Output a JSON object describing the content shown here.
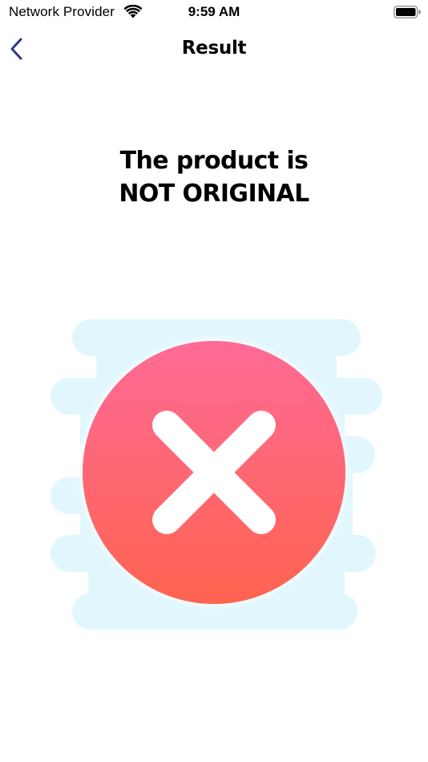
{
  "status_bar": {
    "carrier": "Network Provider",
    "time": "9:59 AM",
    "wifi_icon": "wifi-icon",
    "battery_icon": "battery-icon"
  },
  "nav": {
    "title": "Result",
    "back_icon": "chevron-left-icon"
  },
  "result": {
    "line1": "The product is",
    "line2": "NOT ORIGINAL",
    "status_icon": "x-circle-icon"
  },
  "colors": {
    "accent": "#2B3A8F",
    "error_top": "#FF6A96",
    "error_bottom": "#FF6450",
    "cloud": "#E1F7FD"
  }
}
